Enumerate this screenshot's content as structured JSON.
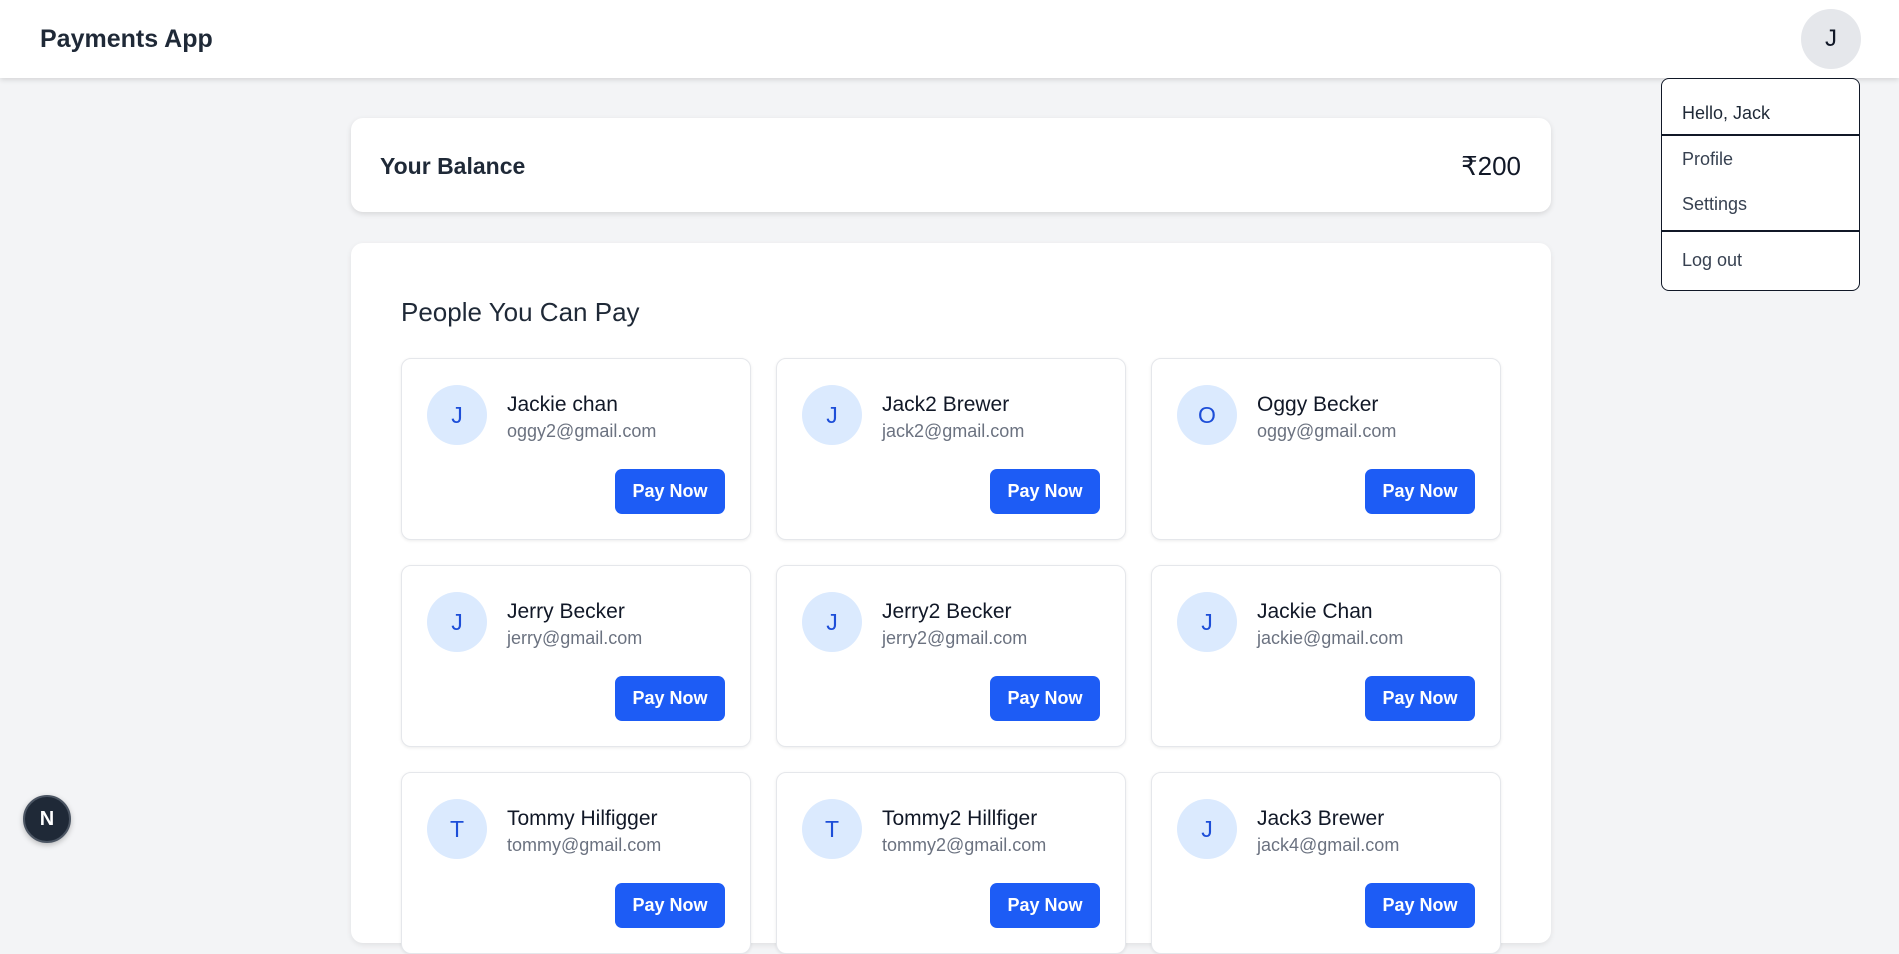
{
  "header": {
    "title": "Payments App",
    "avatar_initial": "J"
  },
  "user_menu": {
    "greeting": "Hello, Jack",
    "items": [
      "Profile",
      "Settings"
    ],
    "logout": "Log out"
  },
  "balance": {
    "label": "Your Balance",
    "amount": "₹200"
  },
  "people": {
    "title": "People You Can Pay",
    "pay_label": "Pay Now",
    "list": [
      {
        "initial": "J",
        "name": "Jackie chan",
        "email": "oggy2@gmail.com"
      },
      {
        "initial": "J",
        "name": "Jack2 Brewer",
        "email": "jack2@gmail.com"
      },
      {
        "initial": "O",
        "name": "Oggy Becker",
        "email": "oggy@gmail.com"
      },
      {
        "initial": "J",
        "name": "Jerry Becker",
        "email": "jerry@gmail.com"
      },
      {
        "initial": "J",
        "name": "Jerry2 Becker",
        "email": "jerry2@gmail.com"
      },
      {
        "initial": "J",
        "name": "Jackie Chan",
        "email": "jackie@gmail.com"
      },
      {
        "initial": "T",
        "name": "Tommy Hilfigger",
        "email": "tommy@gmail.com"
      },
      {
        "initial": "T",
        "name": "Tommy2 Hillfiger",
        "email": "tommy2@gmail.com"
      },
      {
        "initial": "J",
        "name": "Jack3 Brewer",
        "email": "jack4@gmail.com"
      }
    ]
  },
  "dev_badge": {
    "label": "N"
  },
  "colors": {
    "primary": "#1d5cf5",
    "avatar_bg": "#dbeafe",
    "page_bg": "#f3f4f6"
  }
}
